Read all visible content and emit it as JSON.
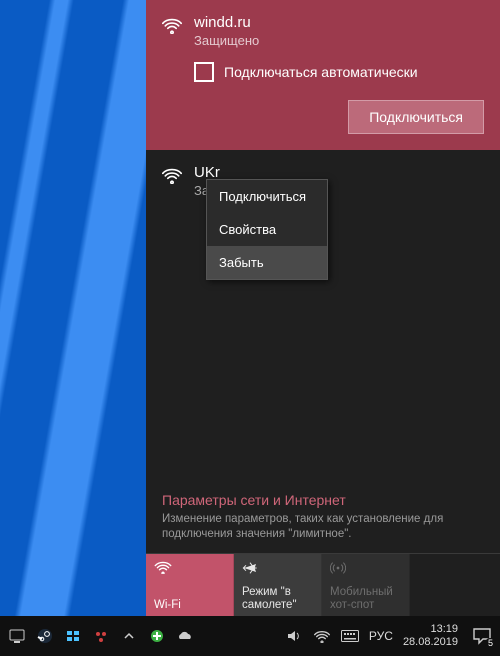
{
  "networks": [
    {
      "name": "windd.ru",
      "status": "Защищено",
      "auto_connect_label": "Подключаться автоматически",
      "connect_label": "Подключиться"
    },
    {
      "name": "UKr",
      "status": "Защ"
    }
  ],
  "context_menu": {
    "items": [
      "Подключиться",
      "Свойства",
      "Забыть"
    ]
  },
  "settings": {
    "title": "Параметры сети и Интернет",
    "desc": "Изменение параметров, таких как установление для подключения значения \"лимитное\"."
  },
  "tiles": [
    {
      "label": "Wi-Fi",
      "icon": "wifi",
      "state": "active"
    },
    {
      "label": "Режим \"в самолете\"",
      "icon": "airplane",
      "state": "normal"
    },
    {
      "label": "Мобильный хот-спот",
      "icon": "hotspot",
      "state": "disabled"
    }
  ],
  "taskbar": {
    "lang": "РУС",
    "time": "13:19",
    "date": "28.08.2019",
    "notif_count": "5"
  }
}
